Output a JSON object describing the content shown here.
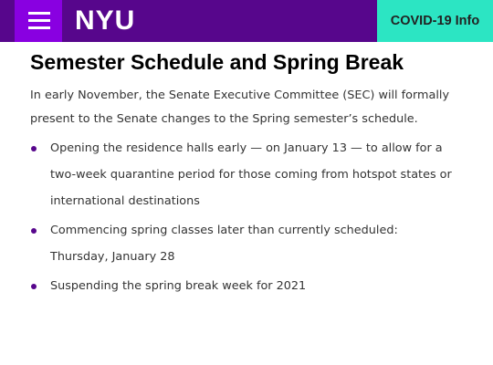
{
  "header": {
    "logo_text": "NYU",
    "covid_button_label": "COVID-19 Info"
  },
  "article": {
    "heading": "Semester Schedule and Spring Break",
    "intro": "In early November, the Senate Executive Committee (SEC) will formally present to the Senate changes to the Spring semester’s schedule.",
    "bullets": [
      "Opening the residence halls early — on January 13 — to allow for a two-week quarantine period for those coming from hotspot states or international destinations",
      "Commencing spring classes later than currently scheduled: Thursday, January 28",
      "Suspending the spring break week for 2021"
    ]
  },
  "colors": {
    "header_background": "#57068c",
    "menu_button_background": "#8900e1",
    "covid_button_background": "#2ce5c3",
    "bullet_color": "#57068c"
  },
  "icons": {
    "menu": "hamburger-menu-icon",
    "bullet": "bullet-dot-icon"
  }
}
